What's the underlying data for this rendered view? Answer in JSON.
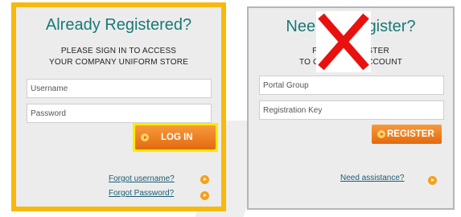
{
  "login_panel": {
    "title": "Already Registered?",
    "subtitle_line1": "PLEASE SIGN IN TO ACCESS",
    "subtitle_line2": "YOUR COMPANY UNIFORM STORE",
    "username_placeholder": "Username",
    "password_placeholder": "Password",
    "login_button": "LOG IN",
    "forgot_username": "Forgot username?",
    "forgot_password": "Forgot Password?"
  },
  "register_panel": {
    "title": "Need to Register?",
    "subtitle_line1": "PLEASE REGISTER",
    "subtitle_line2": "TO CREATE AN ACCOUNT",
    "portal_group_placeholder": "Portal Group",
    "registration_key_placeholder": "Registration Key",
    "register_button": "REGISTER",
    "need_assistance": "Need assistance?"
  },
  "colors": {
    "highlight_border": "#f6b90e",
    "button_highlight": "#ffeb00",
    "button_orange": "#e36a0e",
    "heading_teal": "#187a76",
    "x_overlay_red": "#e8110f"
  },
  "icons": {
    "arrow": "orange-circle-arrow-icon",
    "overlay": "red-x-icon"
  }
}
